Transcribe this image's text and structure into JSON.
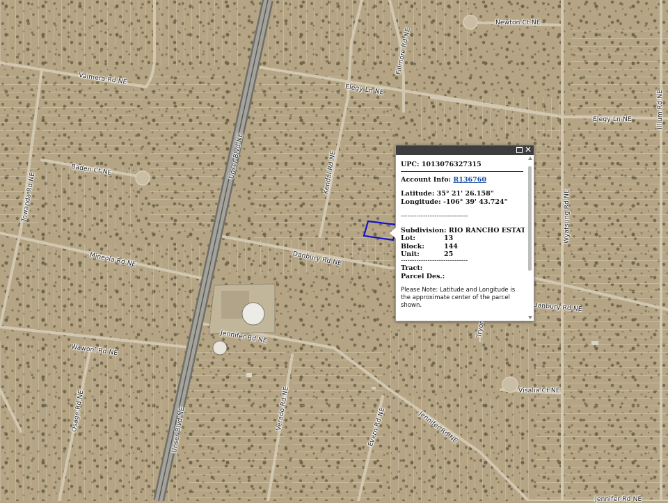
{
  "colors": {
    "terrain": "#b6a585",
    "road": "#d2c8b2",
    "highway": "#8d8d86",
    "parcel_line": "#e4e0d2",
    "selected_parcel": "#1414c8",
    "popup_header": "#3d3d3d"
  },
  "streets": [
    {
      "name": "Newton Ct NE"
    },
    {
      "name": "Valmera Rd NE"
    },
    {
      "name": "Fillmore Rd NE"
    },
    {
      "name": "Elegy Ln NE"
    },
    {
      "name": "Elegy Ln NE"
    },
    {
      "name": "Illium Rd NE"
    },
    {
      "name": "Unser Blvd NE"
    },
    {
      "name": "Baden Ct NE"
    },
    {
      "name": "Kendal Rd NE"
    },
    {
      "name": "Towanda Rd NE"
    },
    {
      "name": "Wyatsung Rd NE"
    },
    {
      "name": "Mineola Rd NE"
    },
    {
      "name": "Danbury Rd NE"
    },
    {
      "name": "Danbury Rd NE"
    },
    {
      "name": "Tryon"
    },
    {
      "name": "Jennifer Rd NE"
    },
    {
      "name": "Wawoni Rd NE"
    },
    {
      "name": "Visalia Ct NE"
    },
    {
      "name": "Osage Rd NE"
    },
    {
      "name": "Verado Rd NE"
    },
    {
      "name": "Evern Rd NE"
    },
    {
      "name": "Jennifer Rd NE"
    },
    {
      "name": "Unser Blvd NE"
    },
    {
      "name": "Jennifer Rd NE"
    }
  ],
  "popup": {
    "upc_label": "UPC:",
    "upc_value": "1013076327315",
    "account_label": "Account Info:",
    "account_value": "R136760",
    "latitude_label": "Latitude:",
    "latitude_value": "35° 21' 26.158\"",
    "longitude_label": "Longitude:",
    "longitude_value": "-106° 39' 43.724\"",
    "separator": "------------------------------",
    "subdivision_label": "Subdivision:",
    "subdivision_value": "RIO RANCHO ESTATES",
    "lot_label": "Lot:",
    "lot_value": "13",
    "block_label": "Block:",
    "block_value": "144",
    "unit_label": "Unit:",
    "unit_value": "25",
    "tract_label": "Tract:",
    "parcel_des_label": "Parcel Des.:",
    "note": "Please Note: Latitude and Longitude is the approximate center of the parcel shown.",
    "close_glyph": "✕"
  }
}
